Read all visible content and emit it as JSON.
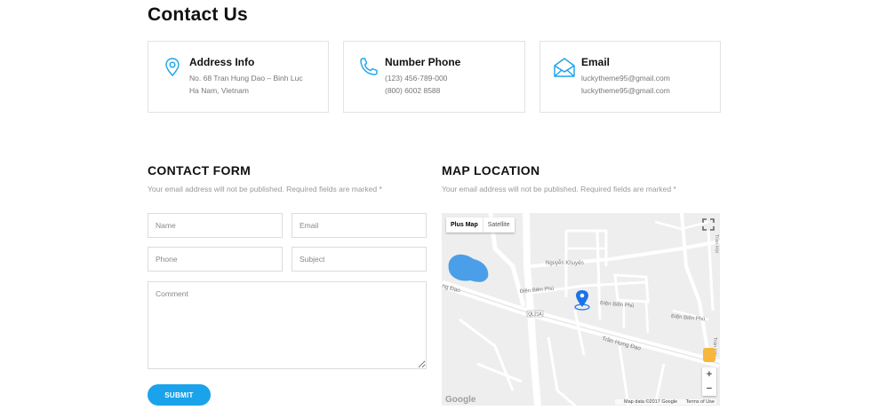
{
  "page": {
    "title": "Contact Us"
  },
  "info_cards": [
    {
      "icon": "map-pin-icon",
      "title": "Address Info",
      "lines": [
        "No. 68 Tran Hung Dao – Binh Luc",
        "Ha Nam, Vietnam"
      ]
    },
    {
      "icon": "phone-icon",
      "title": "Number Phone",
      "lines": [
        "(123) 456-789-000",
        "(800) 6002 8588"
      ]
    },
    {
      "icon": "envelope-icon",
      "title": "Email",
      "lines": [
        "luckytheme95@gmail.com",
        "luckytheme95@gmail.com"
      ]
    }
  ],
  "contact_form": {
    "title": "CONTACT FORM",
    "note": "Your email address will not be published. Required fields are marked *",
    "name_placeholder": "Name",
    "email_placeholder": "Email",
    "phone_placeholder": "Phone",
    "subject_placeholder": "Subject",
    "comment_placeholder": "Comment",
    "submit_label": "SUBMIT"
  },
  "map_section": {
    "title": "MAP LOCATION",
    "note": "Your email address will not be published. Required fields are marked *"
  },
  "map": {
    "type_map": "Plus Map",
    "type_satellite": "Satellite",
    "labels": {
      "street1": "Nguyễn Khuyến",
      "street2": "Điện Biên Phủ",
      "street3": "Điện Biên Phủ",
      "street4": "Điện Biên Phủ",
      "street5": "Trần Hưng Đạo",
      "street6": "ng Đạo",
      "street7": "Trần Hội",
      "street8": "Trần Hội",
      "route": "QL21A"
    },
    "zoom_in": "+",
    "zoom_out": "−",
    "google": "Google",
    "map_data": "Map data ©2017 Google",
    "terms": "Terms of Use"
  },
  "colors": {
    "accent": "#1aa3ea",
    "map_bg": "#eeeeee",
    "water": "#4a9fe8",
    "pin": "#1a73e8"
  }
}
